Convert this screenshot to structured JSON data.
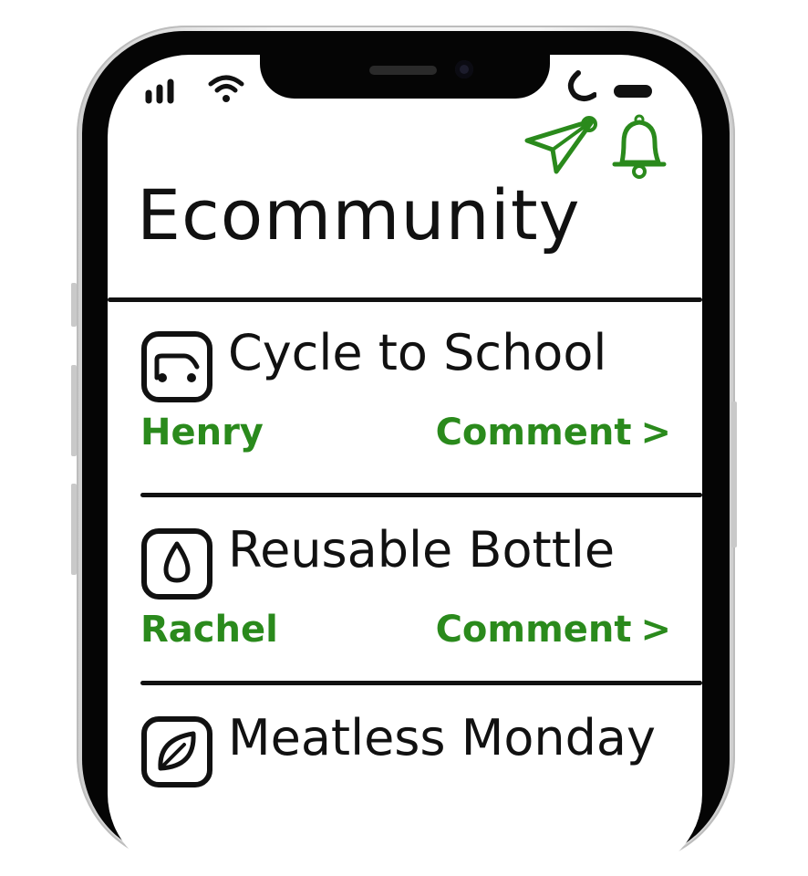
{
  "app": {
    "title": "Ecommunity"
  },
  "header_icons": {
    "send": "paper-plane-icon",
    "notifications": "bell-icon"
  },
  "status_bar": {
    "signal": "signal-icon",
    "wifi": "wifi-icon",
    "focus": "moon-icon",
    "battery": "battery-icon"
  },
  "feed": [
    {
      "title": "Cycle to School",
      "author": "Henry",
      "comment_label": "Comment",
      "icon": "bicycle-icon"
    },
    {
      "title": "Reusable Bottle",
      "author": "Rachel",
      "comment_label": "Comment",
      "icon": "water-drop-icon"
    },
    {
      "title": "Meatless Monday",
      "icon": "leaf-icon"
    }
  ],
  "colors": {
    "accent": "#2a8a1c",
    "ink": "#111111"
  }
}
